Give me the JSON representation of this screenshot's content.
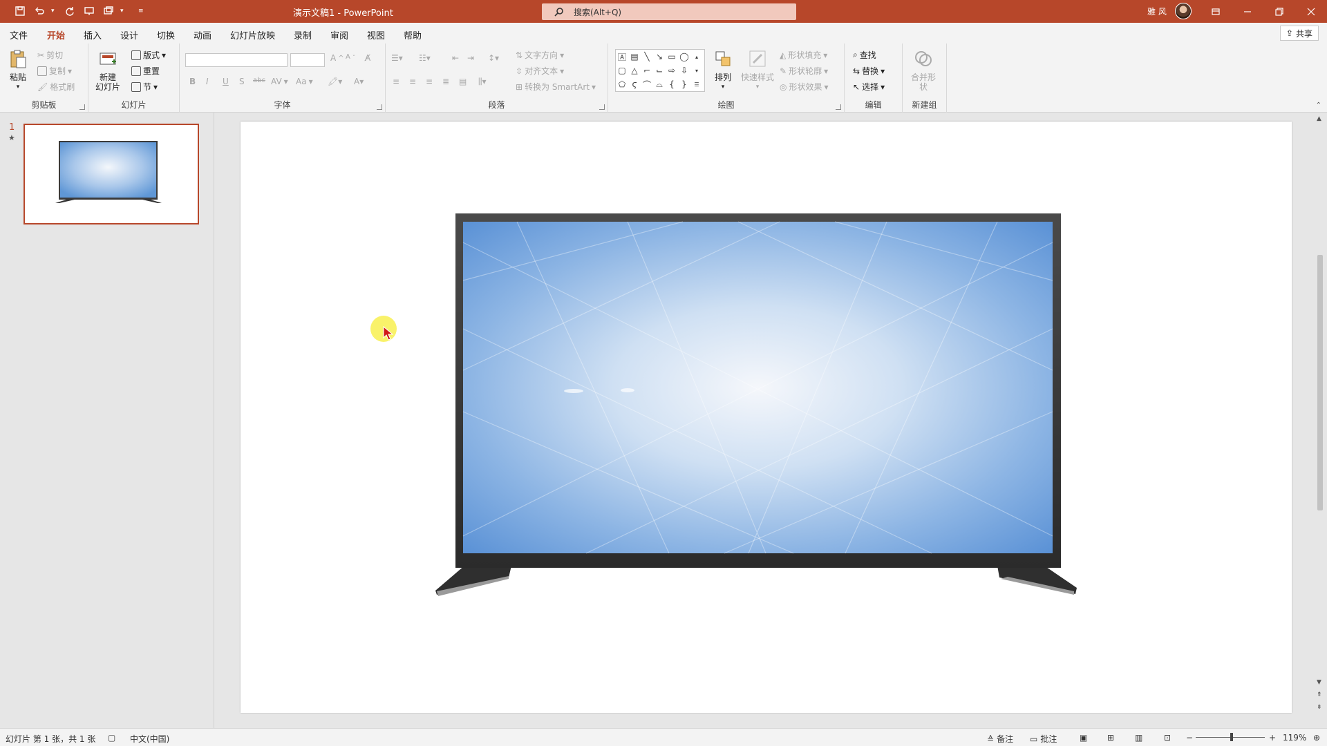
{
  "title_bar": {
    "doc_title": "演示文稿1  -  PowerPoint",
    "search_placeholder": "搜索(Alt+Q)",
    "user_name": "雅 风",
    "accent_color": "#b7472a"
  },
  "menu_tabs": [
    "文件",
    "开始",
    "插入",
    "设计",
    "切换",
    "动画",
    "幻灯片放映",
    "录制",
    "审阅",
    "视图",
    "帮助"
  ],
  "active_tab": "开始",
  "share_label": "共享",
  "ribbon": {
    "clipboard": {
      "label": "剪贴板",
      "paste": "粘贴",
      "cut": "剪切",
      "copy": "复制",
      "format_painter": "格式刷"
    },
    "slides": {
      "label": "幻灯片",
      "new_slide": "新建",
      "new_slide2": "幻灯片",
      "layout": "版式",
      "reset": "重置",
      "section": "节"
    },
    "font": {
      "label": "字体",
      "aa": "Aa",
      "bold": "B",
      "italic": "I",
      "underline": "U",
      "shadow": "S",
      "strike": "abc",
      "spacing": "AV",
      "grow": "A",
      "shrink": "A"
    },
    "paragraph": {
      "label": "段落",
      "text_direction": "文字方向",
      "align_text": "对齐文本",
      "smartart": "转换为 SmartArt"
    },
    "drawing": {
      "label": "绘图",
      "arrange": "排列",
      "quick_styles": "快速样式",
      "fill": "形状填充",
      "outline": "形状轮廓",
      "effects": "形状效果"
    },
    "editing": {
      "label": "编辑",
      "find": "查找",
      "replace": "替换",
      "select": "选择"
    },
    "new_group": {
      "label": "新建组",
      "merge": "合并形",
      "merge2": "状"
    }
  },
  "slide_panel": {
    "slide_number": "1",
    "star": "★"
  },
  "status_bar": {
    "slide_info": "幻灯片 第 1 张，共 1 张",
    "language": "中文(中国)",
    "notes": "备注",
    "comments": "批注",
    "zoom": "119%"
  }
}
